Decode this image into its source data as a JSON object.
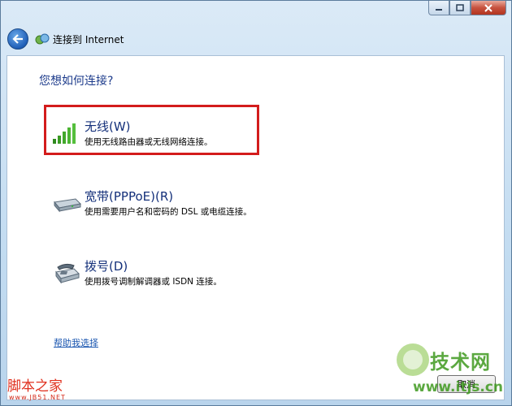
{
  "window": {
    "title": "连接到 Internet"
  },
  "page": {
    "heading": "您想如何连接?",
    "options": [
      {
        "label": "无线(W)",
        "description": "使用无线路由器或无线网络连接。"
      },
      {
        "label": "宽带(PPPoE)(R)",
        "description": "使用需要用户名和密码的 DSL 或电缆连接。"
      },
      {
        "label": "拨号(D)",
        "description": "使用拨号调制解调器或 ISDN 连接。"
      }
    ],
    "help_link": "帮助我选择",
    "cancel_label": "取消"
  },
  "watermarks": {
    "left_text": "脚本之家",
    "left_sub": "www.JB51.NET",
    "right_text": "技术网",
    "right_sub": "www.itjs.cn"
  },
  "colors": {
    "heading": "#1e3c8c",
    "highlight_border": "#d31c1c",
    "link": "#1a56b0"
  }
}
